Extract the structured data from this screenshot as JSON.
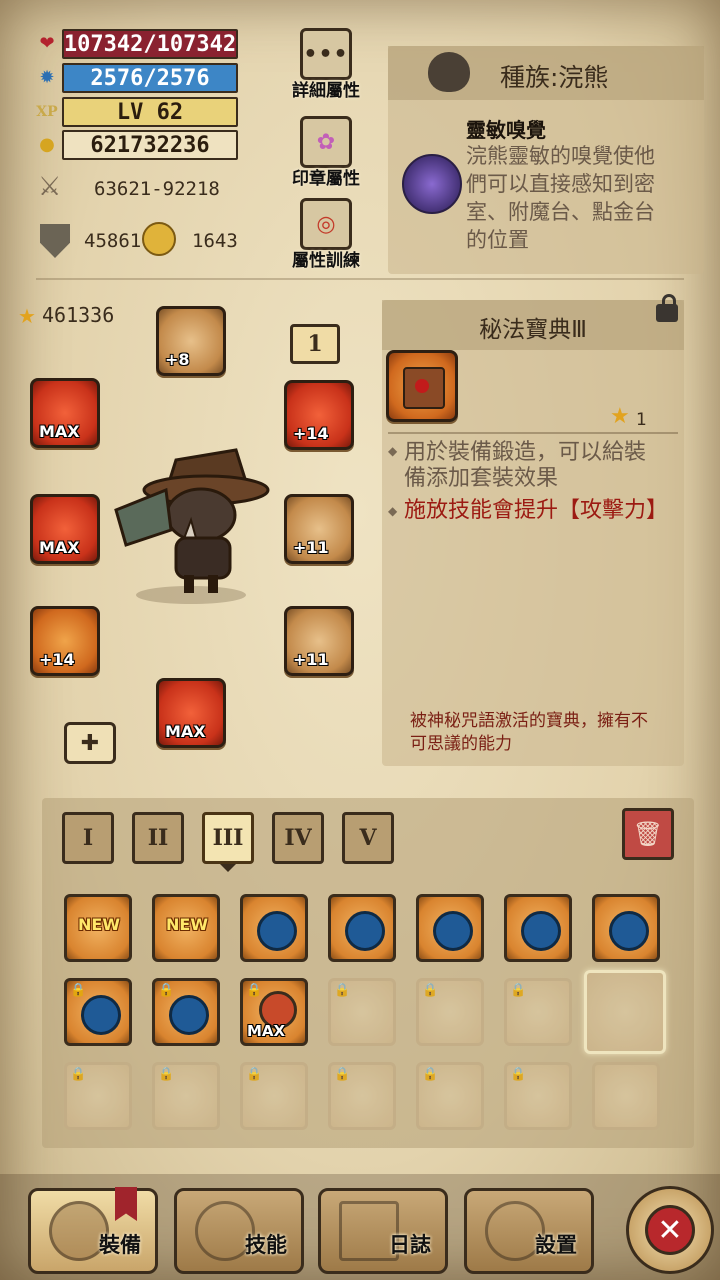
{
  "stats": {
    "hp": "107342/107342",
    "mp": "2576/2576",
    "level": "LV 62",
    "gold": "621732236",
    "attack": "63621-92218",
    "defense": "45861",
    "resource": "1643",
    "power": "461336"
  },
  "side_buttons": {
    "detail_attr": "詳細屬性",
    "seal_attr": "印章屬性",
    "attr_train": "屬性訓練"
  },
  "race": {
    "title": "種族:浣熊",
    "skill_name": "靈敏嗅覺",
    "skill_desc": "浣熊靈敏的嗅覺使他們可以直接感知到密室、附魔台、點金台的位置"
  },
  "equip_slots": {
    "badge": "1",
    "head": "+8",
    "weapon_left": "MAX",
    "offhand_left": "MAX",
    "gloves": "+14",
    "amulet": "+14",
    "armor": "+11",
    "boots": "+11",
    "feet": "MAX"
  },
  "item": {
    "name": "秘法寶典Ⅲ",
    "count": "1",
    "desc1": "用於裝備鍛造，可以給裝備添加套裝效果",
    "desc2": "施放技能會提升【攻擊力】",
    "flavor": "被神秘咒語激活的寶典，擁有不可思議的能力"
  },
  "tabs": [
    "I",
    "II",
    "III",
    "IV",
    "V"
  ],
  "inventory_tags": {
    "new": "NEW",
    "max": "MAX"
  },
  "nav": {
    "equip": "裝備",
    "skill": "技能",
    "log": "日誌",
    "settings": "設置"
  },
  "colors": {
    "hp_bar": "#8a2230",
    "mp_bar": "#3d86c6",
    "xp_bar": "#e9d27a",
    "gold_bar": "#efe2c0",
    "item_red_text": "#9c1a12"
  }
}
